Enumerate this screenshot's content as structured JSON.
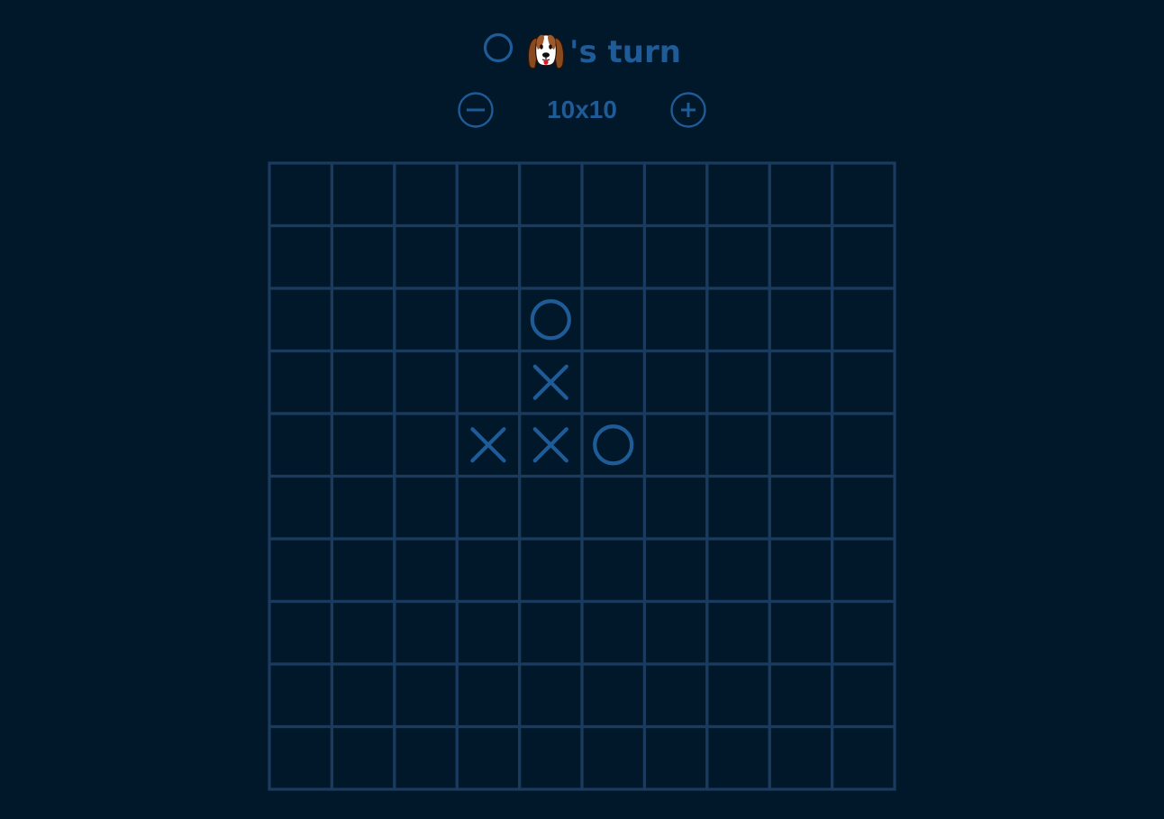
{
  "turn": {
    "player_mark": "O",
    "player_avatar": "dog-face",
    "suffix": "'s turn"
  },
  "board_size": {
    "label": "10x10",
    "rows": 10,
    "cols": 10,
    "decrease_icon": "minus-circle-icon",
    "increase_icon": "plus-circle-icon"
  },
  "board": {
    "cells": [
      [
        "",
        "",
        "",
        "",
        "",
        "",
        "",
        "",
        "",
        ""
      ],
      [
        "",
        "",
        "",
        "",
        "",
        "",
        "",
        "",
        "",
        ""
      ],
      [
        "",
        "",
        "",
        "",
        "O",
        "",
        "",
        "",
        "",
        ""
      ],
      [
        "",
        "",
        "",
        "",
        "X",
        "",
        "",
        "",
        "",
        ""
      ],
      [
        "",
        "",
        "",
        "X",
        "X",
        "O",
        "",
        "",
        "",
        ""
      ],
      [
        "",
        "",
        "",
        "",
        "",
        "",
        "",
        "",
        "",
        ""
      ],
      [
        "",
        "",
        "",
        "",
        "",
        "",
        "",
        "",
        "",
        ""
      ],
      [
        "",
        "",
        "",
        "",
        "",
        "",
        "",
        "",
        "",
        ""
      ],
      [
        "",
        "",
        "",
        "",
        "",
        "",
        "",
        "",
        "",
        ""
      ],
      [
        "",
        "",
        "",
        "",
        "",
        "",
        "",
        "",
        "",
        ""
      ]
    ]
  },
  "colors": {
    "background": "#01172a",
    "grid": "#1a3a5e",
    "mark": "#1e5b97"
  }
}
